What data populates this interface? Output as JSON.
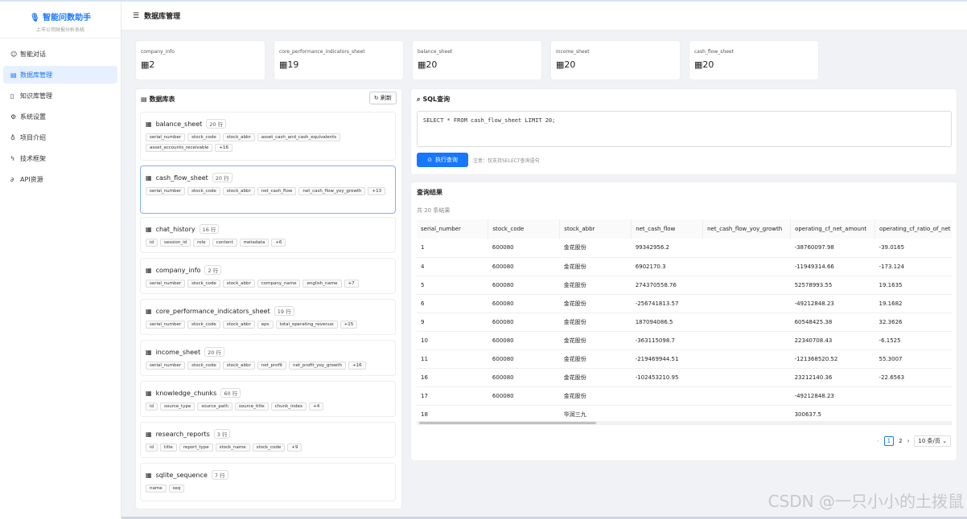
{
  "app": {
    "title": "智能问数助手",
    "subtitle": "上市公司财报分析系统"
  },
  "menu": [
    {
      "icon": "chat-icon",
      "glyph": "☺",
      "label": "智能对话"
    },
    {
      "icon": "database-icon",
      "glyph": "▤",
      "label": "数据库管理"
    },
    {
      "icon": "book-icon",
      "glyph": "▯",
      "label": "知识库管理"
    },
    {
      "icon": "gear-icon",
      "glyph": "⚙",
      "label": "系统设置"
    },
    {
      "icon": "bulb-icon",
      "glyph": "♁",
      "label": "项目介绍"
    },
    {
      "icon": "bolt-icon",
      "glyph": "ϟ",
      "label": "技术框架"
    },
    {
      "icon": "link-icon",
      "glyph": "∂",
      "label": "API资源"
    }
  ],
  "header": {
    "title": "数据库管理"
  },
  "stats": [
    {
      "label": "company_info",
      "value": "2"
    },
    {
      "label": "core_performance_indicators_sheet",
      "value": "19"
    },
    {
      "label": "balance_sheet",
      "value": "20"
    },
    {
      "label": "income_sheet",
      "value": "20"
    },
    {
      "label": "cash_flow_sheet",
      "value": "20"
    }
  ],
  "tables_panel": {
    "title": "数据库表",
    "refresh": "刷新"
  },
  "tables": [
    {
      "name": "balance_sheet",
      "rows": "20 行",
      "cols": [
        "serial_number",
        "stock_code",
        "stock_abbr",
        "asset_cash_and_cash_equivalents",
        "asset_accounts_receivable",
        "+16"
      ]
    },
    {
      "name": "cash_flow_sheet",
      "rows": "20 行",
      "cols": [
        "serial_number",
        "stock_code",
        "stock_abbr",
        "net_cash_flow",
        "net_cash_flow_yoy_growth",
        "+13"
      ]
    },
    {
      "name": "chat_history",
      "rows": "16 行",
      "cols": [
        "id",
        "session_id",
        "role",
        "content",
        "metadata",
        "+6"
      ]
    },
    {
      "name": "company_info",
      "rows": "2 行",
      "cols": [
        "serial_number",
        "stock_code",
        "stock_abbr",
        "company_name",
        "english_name",
        "+7"
      ]
    },
    {
      "name": "core_performance_indicators_sheet",
      "rows": "19 行",
      "cols": [
        "serial_number",
        "stock_code",
        "stock_abbr",
        "eps",
        "total_operating_revenue",
        "+15"
      ]
    },
    {
      "name": "income_sheet",
      "rows": "20 行",
      "cols": [
        "serial_number",
        "stock_code",
        "stock_abbr",
        "net_profit",
        "net_profit_yoy_growth",
        "+16"
      ]
    },
    {
      "name": "knowledge_chunks",
      "rows": "60 行",
      "cols": [
        "id",
        "source_type",
        "source_path",
        "source_title",
        "chunk_index",
        "+4"
      ]
    },
    {
      "name": "research_reports",
      "rows": "3 行",
      "cols": [
        "id",
        "title",
        "report_type",
        "stock_name",
        "stock_code",
        "+9"
      ]
    },
    {
      "name": "sqlite_sequence",
      "rows": "7 行",
      "cols": [
        "name",
        "seq"
      ]
    }
  ],
  "sql": {
    "title": "SQL查询",
    "query": "SELECT * FROM cash_flow_sheet LIMIT 20;",
    "run": "执行查询",
    "note": "注意：仅支持SELECT查询语句"
  },
  "results": {
    "title": "查询结果",
    "count": "共 20 条结果",
    "columns": [
      "serial_number",
      "stock_code",
      "stock_abbr",
      "net_cash_flow",
      "net_cash_flow_yoy_growth",
      "operating_cf_net_amount",
      "operating_cf_ratio_of_net"
    ],
    "rows": [
      [
        "1",
        "600080",
        "金花股份",
        "99342956.2",
        "",
        "-38760097.98",
        "-39.0165"
      ],
      [
        "4",
        "600080",
        "金花股份",
        "6902170.3",
        "",
        "-11949314.66",
        "-173.124"
      ],
      [
        "5",
        "600080",
        "金花股份",
        "274370558.76",
        "",
        "52578993.55",
        "19.1635"
      ],
      [
        "6",
        "600080",
        "金花股份",
        "-256741813.57",
        "",
        "-49212848.23",
        "19.1682"
      ],
      [
        "9",
        "600080",
        "金花股份",
        "187094086.5",
        "",
        "60548425.38",
        "32.3626"
      ],
      [
        "10",
        "600080",
        "金花股份",
        "-363115098.7",
        "",
        "22340708.43",
        "-6.1525"
      ],
      [
        "11",
        "600080",
        "金花股份",
        "-219469944.51",
        "",
        "-121368520.52",
        "55.3007"
      ],
      [
        "16",
        "600080",
        "金花股份",
        "-102453210.95",
        "",
        "23212140.36",
        "-22.6563"
      ],
      [
        "17",
        "600080",
        "金花股份",
        "",
        "",
        "-49212848.23",
        ""
      ],
      [
        "18",
        "",
        "华润三九",
        "",
        "",
        "300637.5",
        ""
      ]
    ],
    "pager": {
      "page1": "1",
      "page2": "2",
      "size": "10 条/页"
    }
  },
  "watermark": "CSDN @一只小小的土拨鼠"
}
